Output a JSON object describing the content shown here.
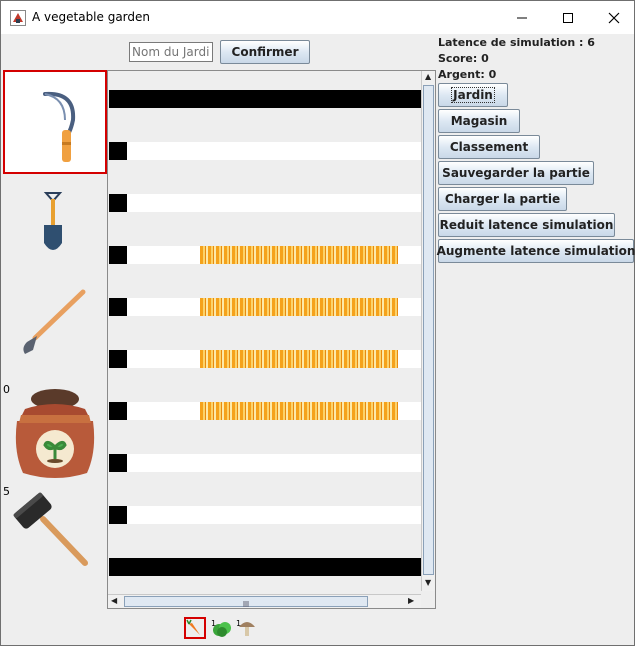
{
  "window": {
    "title": "A vegetable garden"
  },
  "controls": {
    "garden_name_placeholder": "Nom du Jardin",
    "confirm_label": "Confirmer"
  },
  "info": {
    "latency": "Latence de simulation : 6",
    "score": "Score: 0",
    "money": "Argent: 0"
  },
  "menu": [
    {
      "label": "Jardin"
    },
    {
      "label": "Magasin"
    },
    {
      "label": "Classement"
    },
    {
      "label": "Sauvegarder la partie"
    },
    {
      "label": "Charger la partie"
    },
    {
      "label": "Reduit latence simulation"
    },
    {
      "label": "Augmente latence simulation"
    }
  ],
  "tools": {
    "selected": "sickle",
    "seed_bag_count": "0",
    "mallet_count": "5"
  },
  "garden_rows": [
    "black",
    "empty",
    "white",
    "empty",
    "white",
    "empty",
    "white-crop",
    "empty",
    "white-crop",
    "empty",
    "white-crop",
    "empty",
    "white-crop",
    "empty",
    "white",
    "empty",
    "white",
    "empty",
    "black"
  ],
  "seeds": [
    "carrot",
    "salad",
    "mushroom"
  ],
  "colors": {
    "selection": "#d40000",
    "crop": "#f5a21b"
  }
}
